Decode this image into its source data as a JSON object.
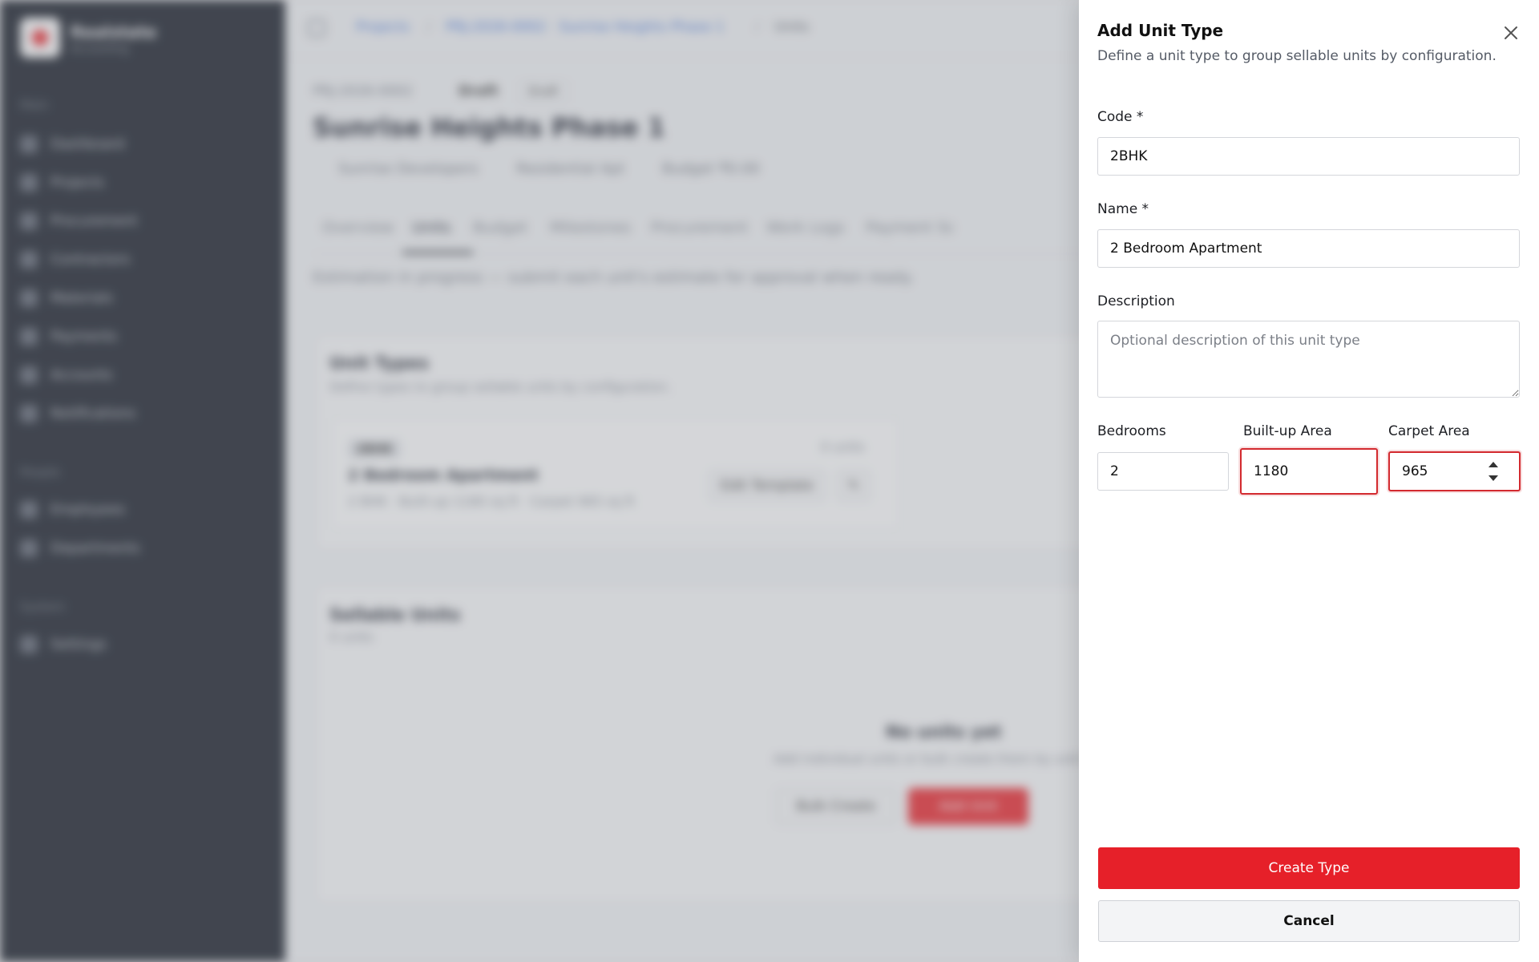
{
  "background": {
    "brand": {
      "name": "Realstate",
      "subtitle": "Accounting"
    },
    "nav_sections": [
      "Main",
      "People",
      "System"
    ],
    "nav_items": [
      "Dashboard",
      "Projects",
      "Procurement",
      "Contractors",
      "Materials",
      "Payments",
      "Accounts",
      "Notifications",
      "Employees",
      "Departments",
      "Settings"
    ],
    "breadcrumbs": [
      "Projects",
      "PRJ-2026-0002 · Sunrise Heights Phase 1",
      "Units"
    ],
    "project_code": "PRJ-2026-0002",
    "status_badge": "Draft",
    "status_pill": "Draft",
    "project_title": "Sunrise Heights Phase 1",
    "developer": "Sunrise Developers",
    "project_type": "Residential Apt",
    "budget": "Budget ₹0.00",
    "tabs": [
      "Overview",
      "Units",
      "Budget",
      "Milestones",
      "Procurement",
      "Work Logs",
      "Payment Sc"
    ],
    "notice": "Estimation in progress — submit each unit's estimate for approval when ready.",
    "unit_types_card": {
      "title": "Unit Types",
      "subtitle": "Define types to group sellable units by configuration."
    },
    "unit_type": {
      "code": "2BHK",
      "units": "0 units",
      "name": "2 Bedroom Apartment",
      "specs": "2 BHK · Built-up 1180 sq ft · Carpet 965 sq ft",
      "edit_template": "Edit Template"
    },
    "sellable_units_card": {
      "title": "Sellable Units",
      "count": "0 units",
      "empty_title": "No units yet",
      "empty_sub": "Add individual units or bulk create them by unit type",
      "bulk_create": "Bulk Create",
      "add_unit": "Add Unit"
    }
  },
  "panel": {
    "title": "Add Unit Type",
    "description": "Define a unit type to group sellable units by configuration.",
    "close_icon": "close-icon",
    "code": {
      "label": "Code *",
      "value": "2BHK"
    },
    "name": {
      "label": "Name *",
      "value": "2 Bedroom Apartment"
    },
    "description_field": {
      "label": "Description",
      "placeholder": "Optional description of this unit type",
      "value": ""
    },
    "bedrooms": {
      "label": "Bedrooms",
      "value": "2"
    },
    "built_up_area": {
      "label": "Built-up Area",
      "value": "1180"
    },
    "carpet_area": {
      "label": "Carpet Area",
      "value": "965"
    },
    "submit_label": "Create Type",
    "cancel_label": "Cancel"
  },
  "colors": {
    "accent": "#e62029",
    "invalid_border": "#d32a2f",
    "sidebar": "#141a26"
  }
}
